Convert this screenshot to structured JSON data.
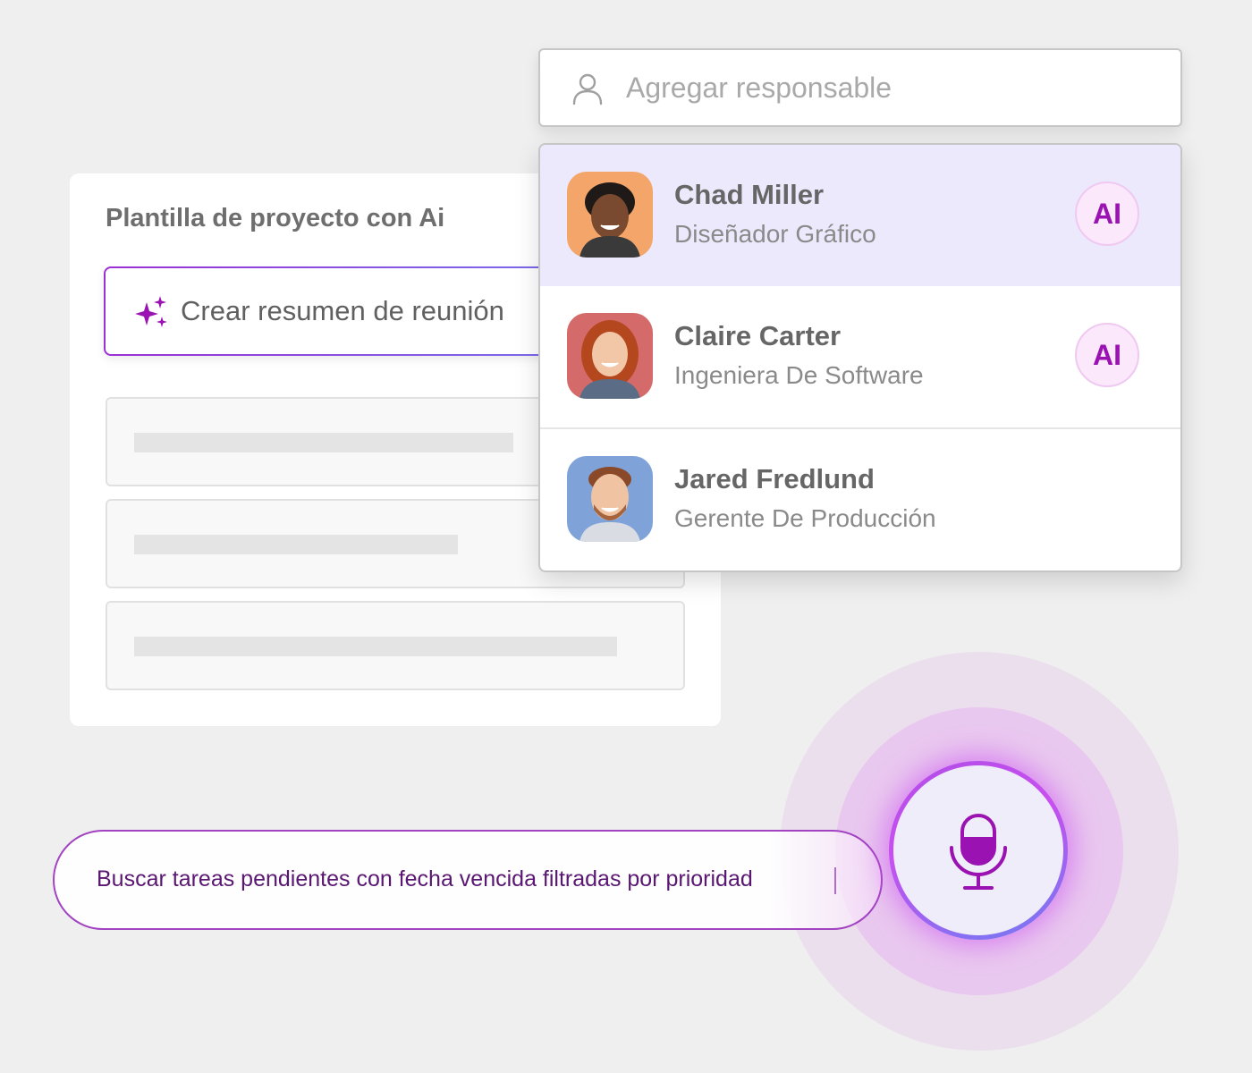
{
  "template_card": {
    "title": "Plantilla de proyecto con Ai",
    "ai_action_label": "Crear resumen de reunión"
  },
  "assignee": {
    "placeholder": "Agregar responsable"
  },
  "people": [
    {
      "name": "Chad Miller",
      "role": "Diseñador Gráfico",
      "badge": "AI",
      "selected": true,
      "avatar_bg": "#f4a66a"
    },
    {
      "name": "Claire Carter",
      "role": "Ingeniera De Software",
      "badge": "AI",
      "selected": false,
      "avatar_bg": "#d46a6a"
    },
    {
      "name": "Jared Fredlund",
      "role": "Gerente De Producción",
      "badge": "",
      "selected": false,
      "avatar_bg": "#7fa3d9"
    }
  ],
  "voice_search": {
    "query": "Buscar tareas pendientes con fecha vencida filtradas por prioridad"
  },
  "colors": {
    "accent": "#9a12b2",
    "selected_row": "#ede9fc",
    "mic_ring": "#c84ff0"
  }
}
